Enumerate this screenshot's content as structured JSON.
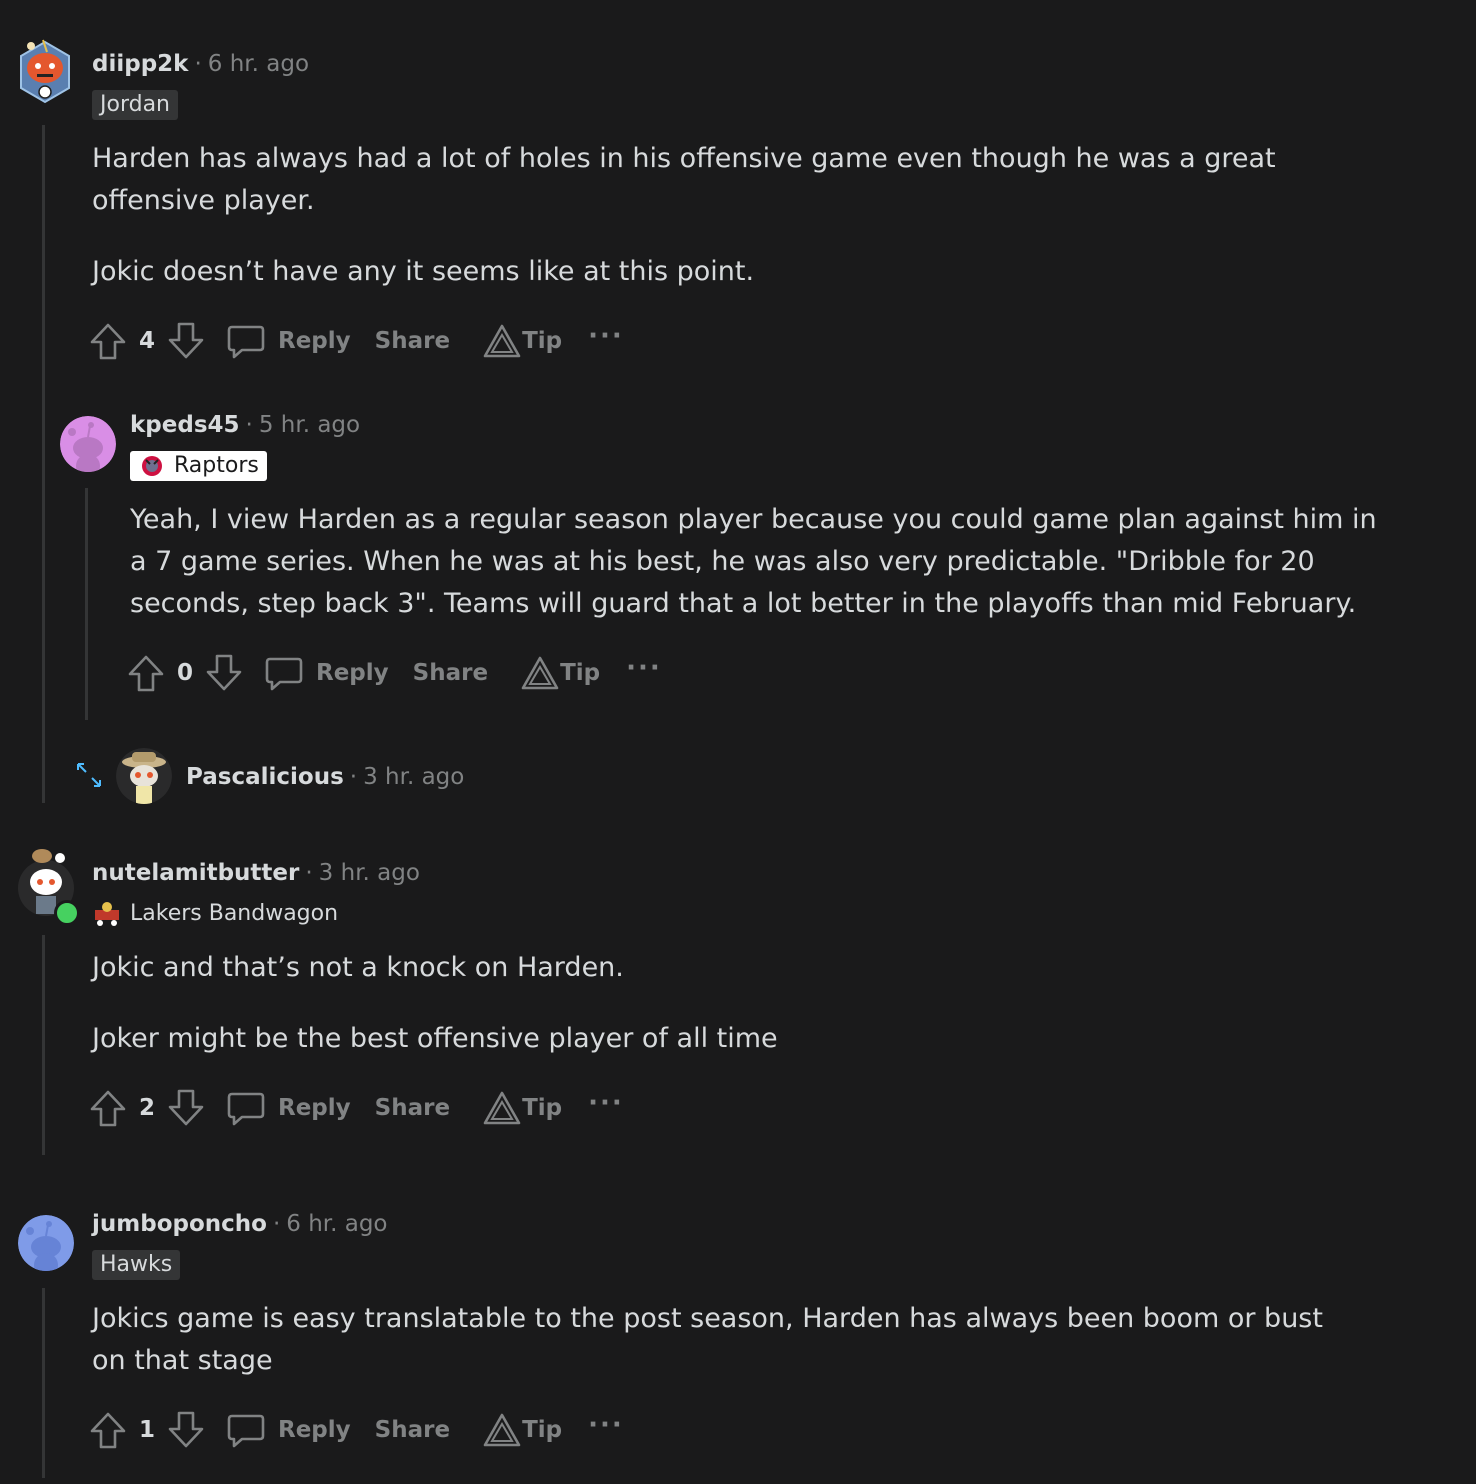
{
  "comments": [
    {
      "username": "diipp2k",
      "separator": "·",
      "time": "6 hr. ago",
      "flair": "Jordan",
      "paragraphs": [
        "Harden has always had a lot of holes in his offensive game even though he was a great offensive player.",
        "Jokic doesn’t have any it seems like at this point."
      ],
      "votes": "4",
      "reply": "Reply",
      "share": "Share",
      "tip": "Tip",
      "more": "···"
    },
    {
      "username": "kpeds45",
      "separator": "·",
      "time": "5 hr. ago",
      "flair": "Raptors",
      "paragraphs": [
        "Yeah, I view Harden as a regular season player because you could game plan against him in a 7 game series. When he was at his best, he was also very predictable. \"Dribble for 20 seconds, step back 3\". Teams will guard that a lot better in the playoffs than mid February."
      ],
      "votes": "0",
      "reply": "Reply",
      "share": "Share",
      "tip": "Tip",
      "more": "···"
    },
    {
      "username": "Pascalicious",
      "separator": "·",
      "time": "3 hr. ago"
    },
    {
      "username": "nutelamitbutter",
      "separator": "·",
      "time": "3 hr. ago",
      "flair": "Lakers Bandwagon",
      "paragraphs": [
        "Jokic and that’s not a knock on Harden.",
        "Joker might be the best offensive player of all time"
      ],
      "votes": "2",
      "reply": "Reply",
      "share": "Share",
      "tip": "Tip",
      "more": "···"
    },
    {
      "username": "jumboponcho",
      "separator": "·",
      "time": "6 hr. ago",
      "flair": "Hawks",
      "paragraphs": [
        "Jokics game is easy translatable to the post season, Harden has always been boom or bust on that stage"
      ],
      "votes": "1",
      "reply": "Reply",
      "share": "Share",
      "tip": "Tip",
      "more": "···"
    }
  ],
  "colors": {
    "background": "#1a1a1b",
    "text": "#d7dadc",
    "muted": "#818384",
    "thread_line": "#343536",
    "online": "#46d160",
    "expand_icon": "#4fbcff"
  },
  "icons": {
    "upvote": "upvote-arrow-icon",
    "downvote": "downvote-arrow-icon",
    "reply": "speech-bubble-icon",
    "tip": "triangle-tip-icon",
    "more": "ellipsis-icon",
    "expand": "expand-arrows-icon"
  }
}
